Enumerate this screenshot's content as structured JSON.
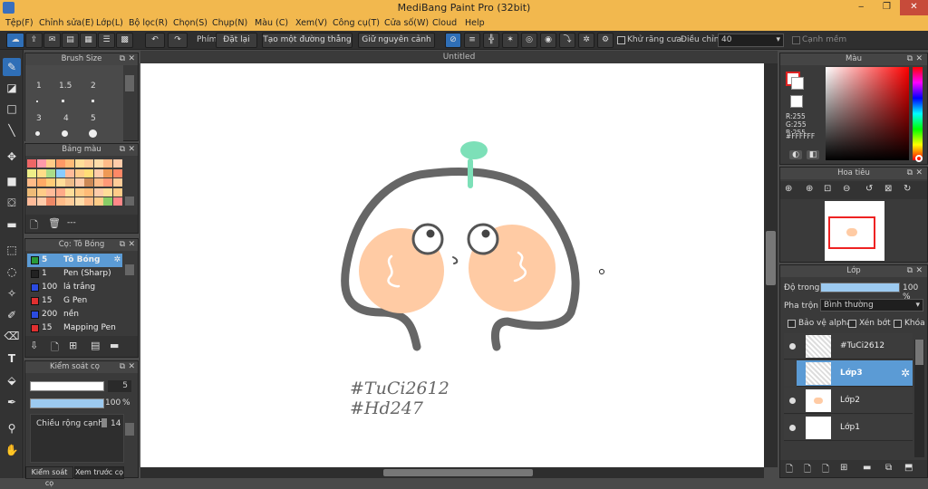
{
  "window": {
    "title": "MediBang Paint Pro (32bit)",
    "minimize": "‒",
    "maximize": "❐",
    "close": "✕"
  },
  "menu": [
    "Tệp(F)",
    "Chỉnh sửa(E)",
    "Lớp(L)",
    "Bộ lọc(R)",
    "Chọn(S)",
    "Chụp(N)",
    "Màu (C)",
    "Xem(V)",
    "Công cụ(T)",
    "Cửa số(W)",
    "Cloud",
    "Help"
  ],
  "toolbar": {
    "phim_label": "Phím",
    "reset_label": "Đặt lại",
    "straight_line_label": "Tạo một đường thẳng",
    "keep_label": "Giữ nguyên cảnh",
    "antialias_label": "Khử răng cưa",
    "adjust_label": "Điều chỉnh",
    "adjust_value": "40",
    "canh_mem_label": "Cạnh mềm"
  },
  "brush_size": {
    "title": "Brush Size",
    "labels": [
      "1",
      "1.5",
      "2",
      "3",
      "4",
      "5"
    ]
  },
  "palette": {
    "title": "Bảng màu",
    "colors": [
      "#e66",
      "#f9a",
      "#fc8",
      "#f96",
      "#fb7",
      "#fd9",
      "#fc9",
      "#fda",
      "#fb8",
      "#fca",
      "#ee8",
      "#fd8",
      "#ad8",
      "#8cf",
      "#fb9",
      "#fc8",
      "#fd7",
      "#fca",
      "#e95",
      "#f86",
      "#fb8",
      "#fa6",
      "#fc7",
      "#fd9",
      "#eb8",
      "#fca",
      "#c85",
      "#fb8",
      "#f97",
      "#fc9",
      "#eb7",
      "#fc8",
      "#fb9",
      "#fa8",
      "#fd9",
      "#fc8",
      "#fb7",
      "#fca",
      "#fd9",
      "#fc8",
      "#fb9",
      "#fca",
      "#e86",
      "#fb8",
      "#fc9",
      "#fda",
      "#fb8",
      "#fc8",
      "#8c6",
      "#f88",
      "#6cf",
      "#48c",
      "#f8c",
      "#fff",
      "#ccc",
      "#888",
      "#888",
      "#666",
      "#444",
      "#222",
      "#555",
      "#777",
      "#999",
      "#bbb"
    ],
    "dash_label": "---"
  },
  "brushes": {
    "title": "Cọ: Tô Bóng",
    "items": [
      {
        "size": "5",
        "name": "Tô Bóng",
        "color": "#2a9a3a"
      },
      {
        "size": "1",
        "name": "Pen (Sharp)",
        "color": "#222222"
      },
      {
        "size": "100",
        "name": "lá trắng",
        "color": "#2b4be0"
      },
      {
        "size": "15",
        "name": "G Pen",
        "color": "#e03030"
      },
      {
        "size": "200",
        "name": "nền",
        "color": "#2b4be0"
      },
      {
        "size": "15",
        "name": "Mapping Pen",
        "color": "#e03030"
      }
    ]
  },
  "brush_control": {
    "title": "Kiểm soát cọ",
    "size_value": "5",
    "opacity_value": "100",
    "opacity_unit": "%",
    "width_label": "Chiều rộng cạnh",
    "width_value": "14",
    "tab1": "Kiểm soát cọ",
    "tab2": "Xem trước cọ"
  },
  "canvas": {
    "title": "Untitled",
    "tag1": "#TuCi2612",
    "tag2": "#Hd247"
  },
  "color_panel": {
    "title": "Màu",
    "r": "R:255",
    "g": "G:255",
    "b": "B:255",
    "hex": "#FFFFFF"
  },
  "navigator": {
    "title": "Hoa tiêu"
  },
  "layers": {
    "title": "Lớp",
    "opacity_label": "Độ trong",
    "opacity_value": "100 %",
    "opacity_fraction": 1.0,
    "blend_label": "Pha trộn",
    "blend_value": "Bình thường",
    "protect_alpha": "Bảo vệ alpha",
    "clip": "Xén bớt",
    "lock": "Khóa",
    "items": [
      {
        "name": "#TuCi2612",
        "selected": false
      },
      {
        "name": "Lớp3",
        "selected": true
      },
      {
        "name": "Lớp2",
        "selected": false
      },
      {
        "name": "Lớp1",
        "selected": false
      }
    ]
  },
  "colors": {
    "accent": "#2f6fb7",
    "titlebar": "#f2b84e",
    "selected_layer": "#5b9bd5",
    "skin": "#ffcba4",
    "sprout": "#7de0b8"
  }
}
